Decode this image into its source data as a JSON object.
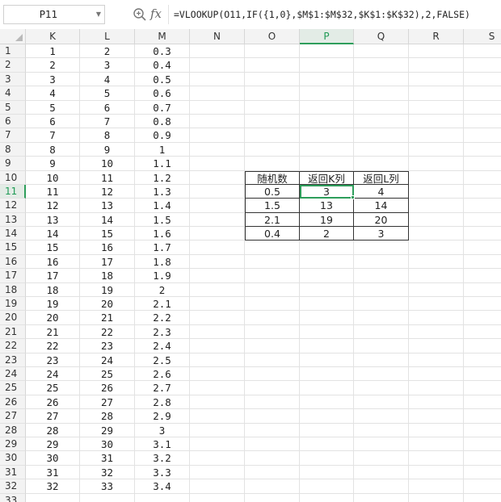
{
  "formula_bar": {
    "name_box": "P11",
    "fx_label": "fx",
    "formula": "=VLOOKUP(O11,IF({1,0},$M$1:$M$32,$K$1:$K$32),2,FALSE)"
  },
  "columns": [
    "K",
    "L",
    "M",
    "N",
    "O",
    "P",
    "Q",
    "R",
    "S"
  ],
  "active_column": "P",
  "active_row": "11",
  "rows": [
    {
      "n": "1",
      "K": "1",
      "L": "2",
      "M": "0.3"
    },
    {
      "n": "2",
      "K": "2",
      "L": "3",
      "M": "0.4"
    },
    {
      "n": "3",
      "K": "3",
      "L": "4",
      "M": "0.5"
    },
    {
      "n": "4",
      "K": "4",
      "L": "5",
      "M": "0.6"
    },
    {
      "n": "5",
      "K": "5",
      "L": "6",
      "M": "0.7"
    },
    {
      "n": "6",
      "K": "6",
      "L": "7",
      "M": "0.8"
    },
    {
      "n": "7",
      "K": "7",
      "L": "8",
      "M": "0.9"
    },
    {
      "n": "8",
      "K": "8",
      "L": "9",
      "M": "1"
    },
    {
      "n": "9",
      "K": "9",
      "L": "10",
      "M": "1.1"
    },
    {
      "n": "10",
      "K": "10",
      "L": "11",
      "M": "1.2",
      "O": "随机数",
      "P": "返回K列",
      "Q": "返回L列"
    },
    {
      "n": "11",
      "K": "11",
      "L": "12",
      "M": "1.3",
      "O": "0.5",
      "P": "3",
      "Q": "4"
    },
    {
      "n": "12",
      "K": "12",
      "L": "13",
      "M": "1.4",
      "O": "1.5",
      "P": "13",
      "Q": "14"
    },
    {
      "n": "13",
      "K": "13",
      "L": "14",
      "M": "1.5",
      "O": "2.1",
      "P": "19",
      "Q": "20"
    },
    {
      "n": "14",
      "K": "14",
      "L": "15",
      "M": "1.6",
      "O": "0.4",
      "P": "2",
      "Q": "3"
    },
    {
      "n": "15",
      "K": "15",
      "L": "16",
      "M": "1.7"
    },
    {
      "n": "16",
      "K": "16",
      "L": "17",
      "M": "1.8"
    },
    {
      "n": "17",
      "K": "17",
      "L": "18",
      "M": "1.9"
    },
    {
      "n": "18",
      "K": "18",
      "L": "19",
      "M": "2"
    },
    {
      "n": "19",
      "K": "19",
      "L": "20",
      "M": "2.1"
    },
    {
      "n": "20",
      "K": "20",
      "L": "21",
      "M": "2.2"
    },
    {
      "n": "21",
      "K": "21",
      "L": "22",
      "M": "2.3"
    },
    {
      "n": "22",
      "K": "22",
      "L": "23",
      "M": "2.4"
    },
    {
      "n": "23",
      "K": "23",
      "L": "24",
      "M": "2.5"
    },
    {
      "n": "24",
      "K": "24",
      "L": "25",
      "M": "2.6"
    },
    {
      "n": "25",
      "K": "25",
      "L": "26",
      "M": "2.7"
    },
    {
      "n": "26",
      "K": "26",
      "L": "27",
      "M": "2.8"
    },
    {
      "n": "27",
      "K": "27",
      "L": "28",
      "M": "2.9"
    },
    {
      "n": "28",
      "K": "28",
      "L": "29",
      "M": "3"
    },
    {
      "n": "29",
      "K": "29",
      "L": "30",
      "M": "3.1"
    },
    {
      "n": "30",
      "K": "30",
      "L": "31",
      "M": "3.2"
    },
    {
      "n": "31",
      "K": "31",
      "L": "32",
      "M": "3.3"
    },
    {
      "n": "32",
      "K": "32",
      "L": "33",
      "M": "3.4"
    },
    {
      "n": "33"
    }
  ],
  "colors": {
    "accent": "#2e9e5b",
    "header_bg": "#f3f3f3",
    "gridline": "#e2e2e2"
  }
}
